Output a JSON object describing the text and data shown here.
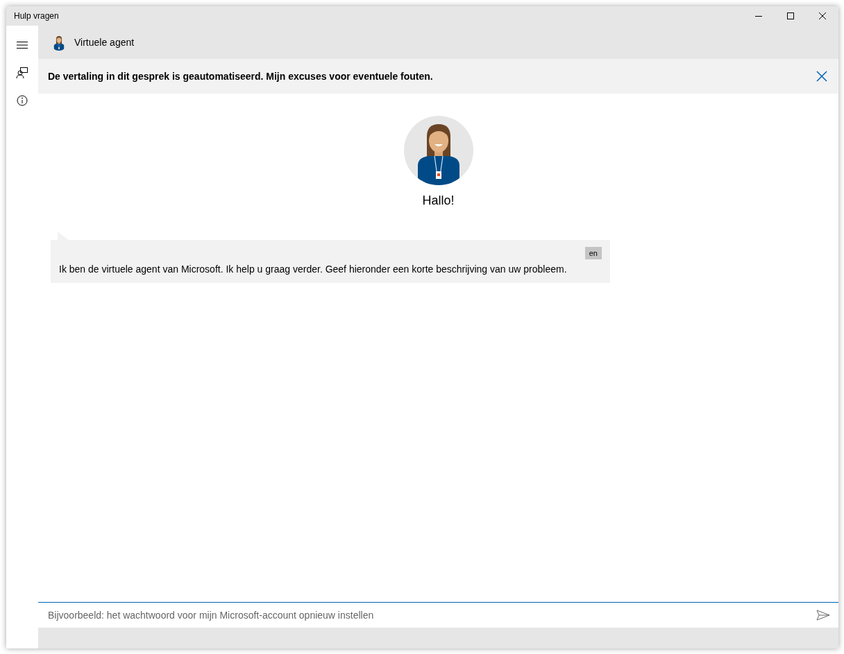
{
  "window": {
    "title": "Hulp vragen"
  },
  "header": {
    "agent_name": "Virtuele agent"
  },
  "banner": {
    "text": "De vertaling in dit gesprek is geautomatiseerd. Mijn excuses voor eventuele fouten."
  },
  "welcome": {
    "greeting": "Hallo!"
  },
  "messages": [
    {
      "language": "en",
      "text": "Ik ben de virtuele agent van Microsoft. Ik help u graag verder. Geef hieronder een korte beschrijving van uw probleem."
    }
  ],
  "composer": {
    "placeholder": "Bijvoorbeeld: het wachtwoord voor mijn Microsoft-account opnieuw instellen"
  }
}
